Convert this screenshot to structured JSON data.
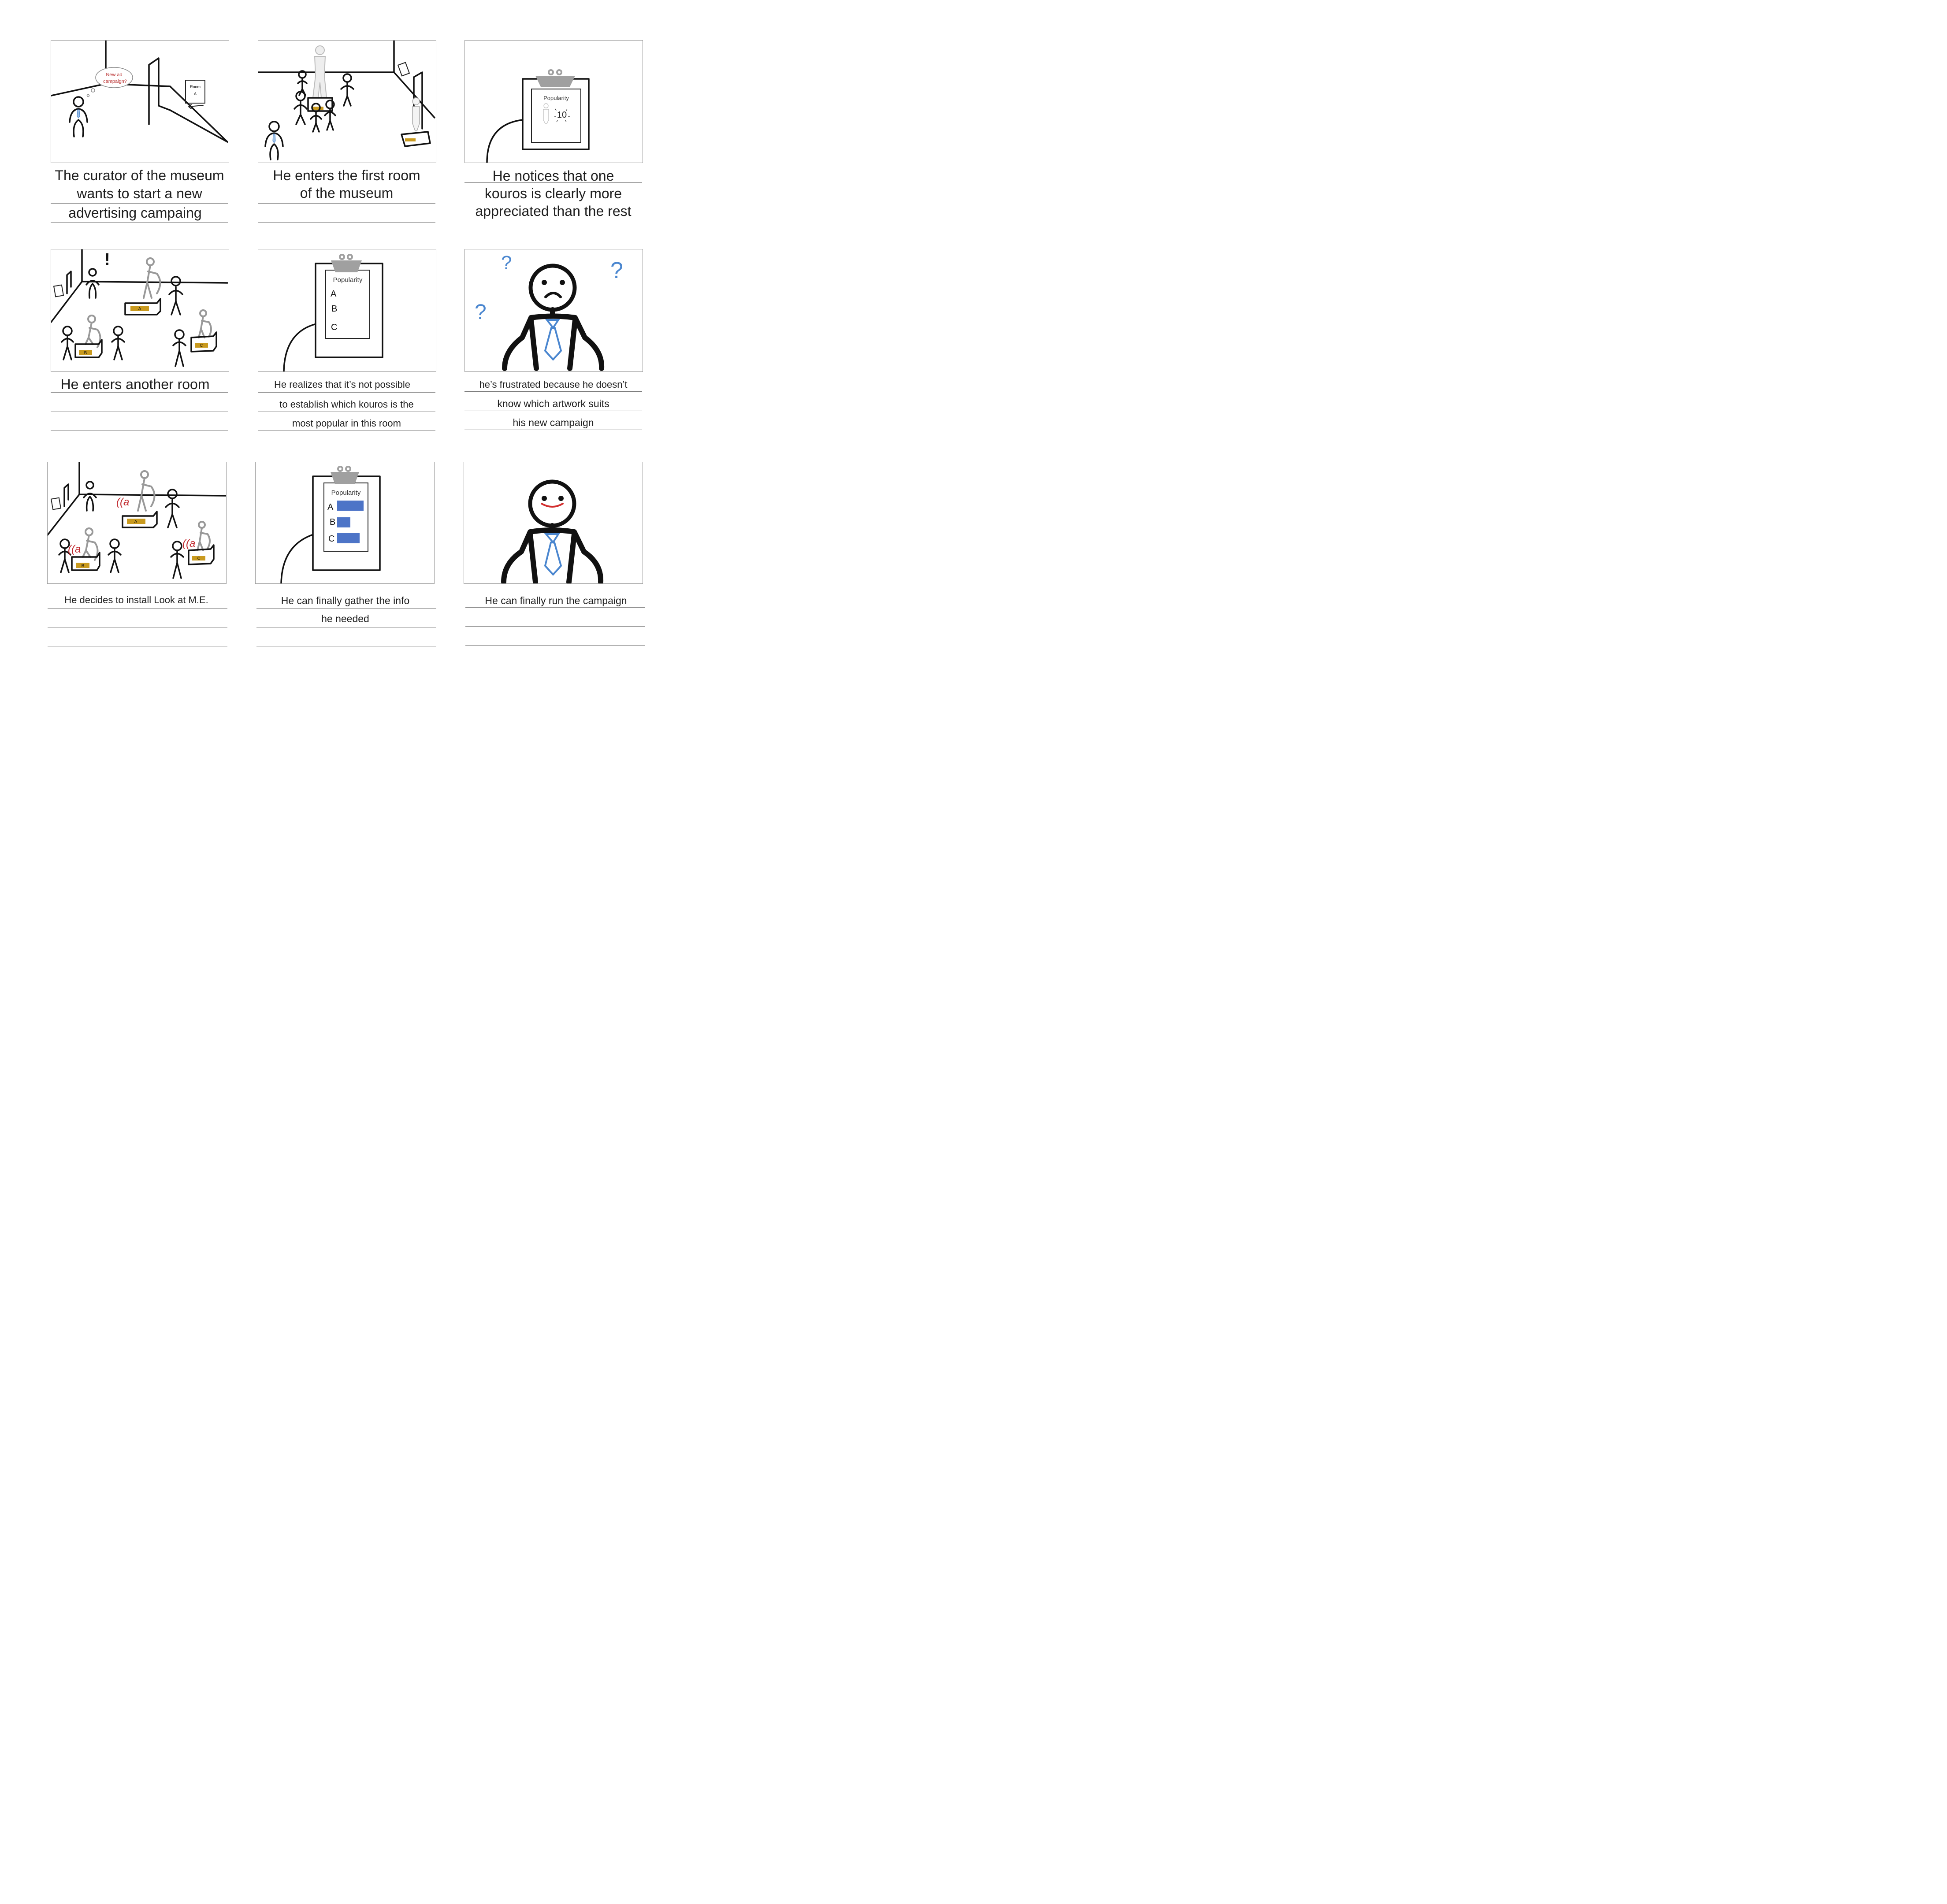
{
  "panels": [
    {
      "caption_lines": [
        "The curator of the museum",
        "wants to start a new",
        "advertising campaing"
      ],
      "thought": [
        "New ad",
        "campaign?"
      ],
      "sign": [
        "Room",
        "A"
      ]
    },
    {
      "caption_lines": [
        "He enters the first room",
        "of the museum",
        ""
      ]
    },
    {
      "caption_lines": [
        "He notices that one",
        "kouros is clearly more",
        "appreciated than the rest"
      ],
      "clipboard_title": "Popularity",
      "score": "10"
    },
    {
      "caption_lines": [
        "He enters another room",
        "",
        ""
      ],
      "exclaim": "!",
      "bases": [
        "A",
        "B",
        "C"
      ]
    },
    {
      "caption_lines": [
        "He realizes that it’s not possible",
        "to establish which kouros is the",
        "most popular in this room"
      ],
      "clipboard_title": "Popularity",
      "rows": [
        "A",
        "B",
        "C"
      ]
    },
    {
      "caption_lines": [
        "he’s frustrated because he doesn’t",
        "know which artwork suits",
        "his new campaign"
      ],
      "marks": [
        "?",
        "?",
        "?"
      ]
    },
    {
      "caption_lines": [
        "He decides to install Look at M.E.",
        "",
        ""
      ],
      "bases": [
        "A",
        "B",
        "C"
      ],
      "signal": "((a"
    },
    {
      "caption_lines": [
        "He can finally gather the info",
        "he needed",
        ""
      ],
      "clipboard_title": "Popularity",
      "rows": [
        "A",
        "B",
        "C"
      ],
      "bars": [
        0.75,
        0.38,
        0.64
      ]
    },
    {
      "caption_lines": [
        "He can finally run the campaign",
        "",
        ""
      ]
    }
  ],
  "colors": {
    "ink": "#111111",
    "tie": "#4a86cf",
    "bar": "#4d74c7",
    "plinth": "#c99a1e",
    "statue": "#9a9a9a",
    "signal": "#c0282d",
    "smile": "#d22e2e"
  }
}
